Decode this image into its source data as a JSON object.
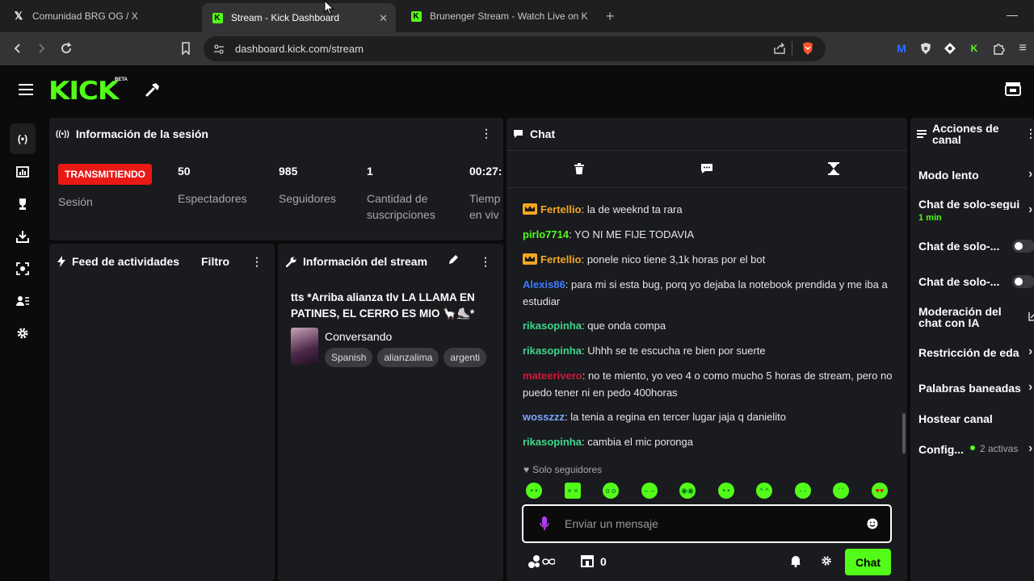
{
  "browser": {
    "tabs": [
      {
        "title": "Comunidad BRG OG / X",
        "icon": "x-logo-icon"
      },
      {
        "title": "Stream - Kick Dashboard",
        "icon": "kick-favicon"
      },
      {
        "title": "Brunenger Stream - Watch Live on Ki",
        "icon": "kick-favicon"
      }
    ],
    "url": "dashboard.kick.com/stream"
  },
  "app": {
    "logo": "KICK",
    "logo_badge": "BETA",
    "brand_color": "#53fc18"
  },
  "session": {
    "title": "Información de la sesión",
    "status": "TRANSMITIENDO",
    "session_label": "Sesión",
    "stats": [
      {
        "value": "50",
        "label": "Espectadores"
      },
      {
        "value": "985",
        "label": "Seguidores"
      },
      {
        "value": "1",
        "label": "Cantidad de suscripciones"
      },
      {
        "value": "00:27:",
        "label": "Tiemp en viv"
      }
    ]
  },
  "feed": {
    "title": "Feed de actividades",
    "filter": "Filtro"
  },
  "stream_info": {
    "title": "Información del stream",
    "stream_title": "tts *Arriba alianza tlv LA LLAMA EN PATINES, EL CERRO ES MIO 🦙⛸️*",
    "category": "Conversando",
    "tags": [
      "Spanish",
      "alianzalima",
      "argenti"
    ]
  },
  "chat": {
    "title": "Chat",
    "messages": [
      {
        "user": "Fertellio",
        "color": "#f5a623",
        "badge": "crown-icon",
        "text": "la de weeknd ta rara"
      },
      {
        "user": "pirlo7714",
        "color": "#53fc18",
        "badge": "",
        "text": "YO NI ME FIJE TODAVIA"
      },
      {
        "user": "Fertellio",
        "color": "#f5a623",
        "badge": "crown-icon",
        "text": "ponele nico tiene 3,1k horas por el bot"
      },
      {
        "user": "Alexis86",
        "color": "#3d7bff",
        "badge": "",
        "text": "para mi si esta bug, porq yo dejaba la notebook prendida y me iba a estudiar"
      },
      {
        "user": "rikasopinha",
        "color": "#3fd68b",
        "badge": "",
        "text": "que onda compa"
      },
      {
        "user": "rikasopinha",
        "color": "#3fd68b",
        "badge": "",
        "text": "Uhhh se te escucha re bien por suerte"
      },
      {
        "user": "mateerivero",
        "color": "#d1193b",
        "badge": "",
        "text": "no te miento, yo veo 4 o como mucho 5 horas de stream, pero no puedo tener ni en pedo 400horas"
      },
      {
        "user": "wosszzz",
        "color": "#7fa6ff",
        "badge": "",
        "text": "la tenia a regina en tercer lugar jaja q danielito"
      },
      {
        "user": "rikasopinha",
        "color": "#3fd68b",
        "badge": "",
        "text": "cambia el mic poronga"
      }
    ],
    "followers_only": "Solo seguidores",
    "input_placeholder": "Enviar un mensaje",
    "points": "0",
    "send_label": "Chat"
  },
  "actions": {
    "title": "Acciones de canal",
    "items": [
      {
        "label": "Modo lento",
        "sub": "",
        "control": "chevron"
      },
      {
        "label": "Chat de solo-segui",
        "sub": "1 min",
        "control": "chevron"
      },
      {
        "label": "Chat de solo-...",
        "sub": "",
        "control": "toggle"
      },
      {
        "label": "Chat de solo-...",
        "sub": "",
        "control": "toggle"
      },
      {
        "label": "Moderación del chat con IA",
        "sub": "",
        "control": "external"
      },
      {
        "label": "Restricción de eda",
        "sub": "",
        "control": "chevron"
      },
      {
        "label": "Palabras baneadas",
        "sub": "",
        "control": "chevron"
      },
      {
        "label": "Hostear canal",
        "sub": "",
        "control": "none"
      },
      {
        "label": "Config...",
        "sub": "2 activas",
        "control": "chevron"
      }
    ]
  }
}
